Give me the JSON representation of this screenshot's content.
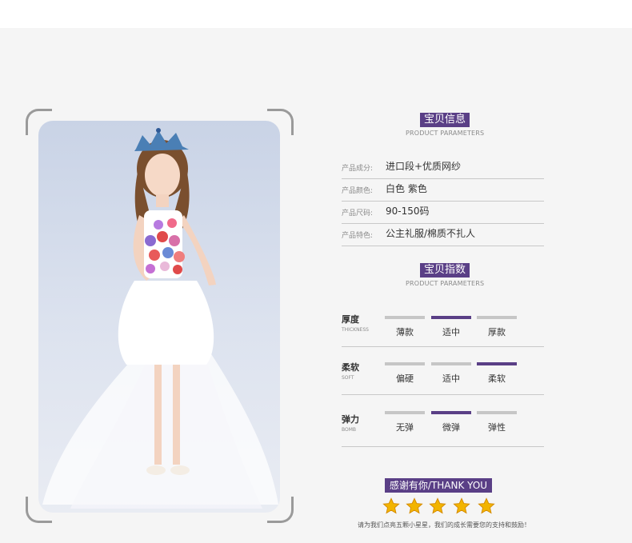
{
  "info_section": {
    "title": "宝贝信息",
    "subtitle": "PRODUCT PARAMETERS",
    "rows": [
      {
        "label": "产品成分:",
        "value": "进口段+优质网纱"
      },
      {
        "label": "产品颜色:",
        "value": "白色 紫色"
      },
      {
        "label": "产品尺码:",
        "value": "90-150码"
      },
      {
        "label": "产品特色:",
        "value": "公主礼服/棉质不扎人"
      }
    ]
  },
  "index_section": {
    "title": "宝贝指数",
    "subtitle": "PRODUCT PARAMETERS",
    "rows": [
      {
        "name": "厚度",
        "en": "THICKNESS",
        "options": [
          "薄款",
          "适中",
          "厚款"
        ],
        "selected_index": 1
      },
      {
        "name": "柔软",
        "en": "SOFT",
        "options": [
          "偏硬",
          "适中",
          "柔软"
        ],
        "selected_index": 2
      },
      {
        "name": "弹力",
        "en": "BOMB",
        "options": [
          "无弹",
          "微弹",
          "弹性"
        ],
        "selected_index": 1
      }
    ]
  },
  "thanks": {
    "label": "感谢有你/THANK YOU",
    "stars": 5,
    "note": "请为我们点亮五颗小星星，我们的成长需要您的支持和鼓励！"
  },
  "colors": {
    "accent": "#5a3f86",
    "bar_inactive": "#c6c6c6",
    "star": "#f2b400"
  },
  "photo": {
    "icon": "product-photo-girl-in-white-flower-dress"
  }
}
